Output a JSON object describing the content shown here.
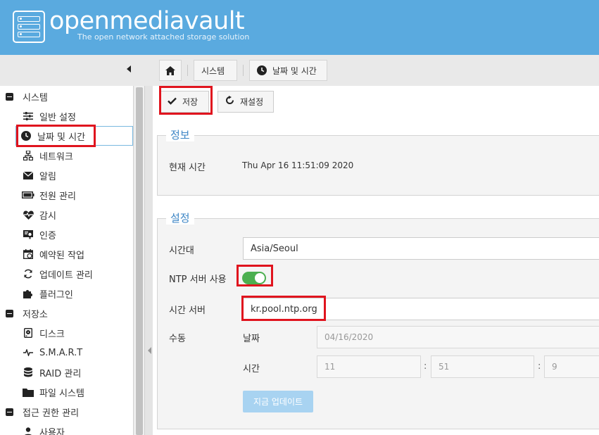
{
  "brand": {
    "name": "openmediavault",
    "tagline": "The open network attached storage solution"
  },
  "breadcrumb": {
    "system": "시스템",
    "current": "날짜 및 시간"
  },
  "sidebar": {
    "groups": [
      {
        "label": "시스템"
      },
      {
        "label": "저장소"
      },
      {
        "label": "접근 권한 관리"
      }
    ],
    "system_items": [
      {
        "label": "일반 설정",
        "icon": "sliders-icon"
      },
      {
        "label": "날짜 및 시간",
        "icon": "clock-icon"
      },
      {
        "label": "네트워크",
        "icon": "network-icon"
      },
      {
        "label": "알림",
        "icon": "envelope-icon"
      },
      {
        "label": "전원 관리",
        "icon": "battery-icon"
      },
      {
        "label": "감시",
        "icon": "heartbeat-icon"
      },
      {
        "label": "인증",
        "icon": "certificate-icon"
      },
      {
        "label": "예약된 작업",
        "icon": "calendar-icon"
      },
      {
        "label": "업데이트 관리",
        "icon": "refresh-icon"
      },
      {
        "label": "플러그인",
        "icon": "puzzle-icon"
      }
    ],
    "storage_items": [
      {
        "label": "디스크",
        "icon": "disk-icon"
      },
      {
        "label": "S.M.A.R.T",
        "icon": "pulse-icon"
      },
      {
        "label": "RAID 관리",
        "icon": "database-icon"
      },
      {
        "label": "파일 시스템",
        "icon": "folder-icon"
      }
    ],
    "access_items": [
      {
        "label": "사용자",
        "icon": "user-icon"
      }
    ]
  },
  "toolbar": {
    "save_label": "저장",
    "reset_label": "재설정"
  },
  "info": {
    "legend": "정보",
    "current_time_label": "현재 시간",
    "current_time_value": "Thu Apr 16 11:51:09 2020"
  },
  "settings": {
    "legend": "설정",
    "timezone_label": "시간대",
    "timezone_value": "Asia/Seoul",
    "ntp_label": "NTP 서버 사용",
    "ntp_enabled": true,
    "time_server_label": "시간 서버",
    "time_server_value": "kr.pool.ntp.org",
    "manual_label": "수동",
    "date_label": "날짜",
    "date_value": "04/16/2020",
    "time_label": "시간",
    "hour_value": "11",
    "minute_value": "51",
    "second_value": "9",
    "time_separator": ":",
    "update_now_label": "지금 업데이트"
  },
  "colors": {
    "header_bg": "#5aaadf",
    "accent": "#3c85c5",
    "toggle_on": "#4caf50",
    "highlight": "#e0141e"
  }
}
